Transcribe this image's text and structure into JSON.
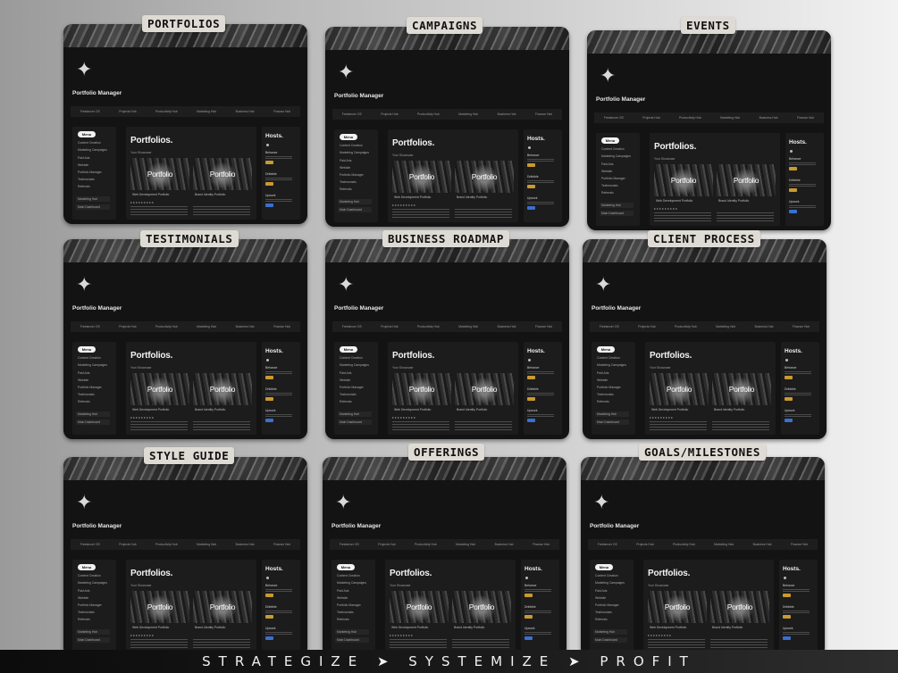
{
  "tagline": "STRATEGIZE ➤ SYSTEMIZE ➤ PROFIT",
  "template": {
    "page_title": "Portfolio Manager",
    "star_icon": "four-point-star-icon",
    "nav": [
      "Freelancer OS",
      "Projects Hub",
      "Productivity Hub",
      "Marketing Hub",
      "Business Hub",
      "Finance Hub"
    ],
    "menu": {
      "button": "Menu",
      "items": [
        "Content Creation",
        "Marketing Campaigns",
        "Paid Ads",
        "Website",
        "Portfolio Manager",
        "Testimonials",
        "Referrals"
      ],
      "footer": [
        "Marketing Hub",
        "Main Dashboard"
      ]
    },
    "main": {
      "title": "Portfolios.",
      "subtitle": "Your Showcase",
      "thumbs": [
        {
          "label": "Portfolio",
          "caption": "Web Development Portfolio"
        },
        {
          "label": "Portfolio",
          "caption": "Brand Identity Portfolio"
        }
      ]
    },
    "hosts": {
      "title": "Hosts.",
      "blocks": [
        {
          "name": "Behance",
          "tag_color": "#c99a2e"
        },
        {
          "name": "Dribbble",
          "tag_color": "#c99a2e"
        },
        {
          "name": "Upwork",
          "tag_color": "#3a6fd1"
        }
      ]
    }
  },
  "cards": [
    {
      "label": "PORTFOLIOS"
    },
    {
      "label": "CAMPAIGNS"
    },
    {
      "label": "EVENTS"
    },
    {
      "label": "TESTIMONIALS"
    },
    {
      "label": "BUSINESS ROADMAP"
    },
    {
      "label": "CLIENT PROCESS"
    },
    {
      "label": "STYLE GUIDE"
    },
    {
      "label": "OFFERINGS"
    },
    {
      "label": "GOALS/MILESTONES"
    }
  ]
}
